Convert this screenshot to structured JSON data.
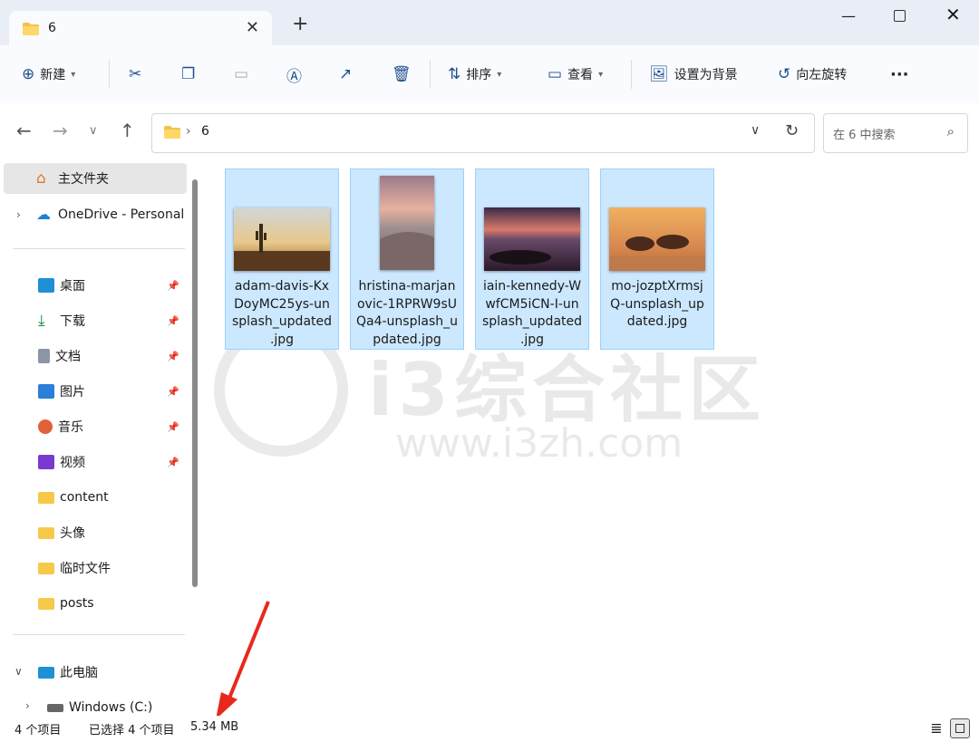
{
  "window": {
    "tab_title": "6",
    "new_tab_icon": "plus-icon"
  },
  "toolbar": {
    "new_label": "新建",
    "sort_label": "排序",
    "view_label": "查看",
    "set_bg_label": "设置为背景",
    "rotate_left_label": "向左旋转",
    "more_label": "···"
  },
  "address": {
    "path": "6",
    "search_placeholder": "在 6 中搜索"
  },
  "sidebar": {
    "home": "主文件夹",
    "onedrive": "OneDrive - Personal",
    "quick": [
      {
        "label": "桌面",
        "icon": "desktop-icon",
        "color": "#1e90d6"
      },
      {
        "label": "下载",
        "icon": "download-icon",
        "color": "#1a8a4a"
      },
      {
        "label": "文档",
        "icon": "document-icon",
        "color": "#6b7a8a"
      },
      {
        "label": "图片",
        "icon": "pictures-icon",
        "color": "#2a7fd8"
      },
      {
        "label": "音乐",
        "icon": "music-icon",
        "color": "#e0603a"
      },
      {
        "label": "视频",
        "icon": "video-icon",
        "color": "#7a3ad0"
      }
    ],
    "folders": [
      "content",
      "头像",
      "临时文件",
      "posts"
    ],
    "this_pc": "此电脑",
    "drive": "Windows (C:)"
  },
  "files": [
    {
      "name": "adam-davis-KxDoyMC25ys-unsplash_updated.jpg",
      "lines": [
        "adam-davis-Kx",
        "DoyMC25ys-un",
        "splash_updated",
        ".jpg"
      ]
    },
    {
      "name": "hristina-marjanovic-1RPRW9sUQa4-unsplash_updated.jpg",
      "lines": [
        "hristina-marjan",
        "ovic-1RPRW9sU",
        "Qa4-unsplash_u",
        "pdated.jpg"
      ]
    },
    {
      "name": "iain-kennedy-WwfCM5iCN-I-unsplash_updated.jpg",
      "lines": [
        "iain-kennedy-W",
        "wfCM5iCN-I-un",
        "splash_updated",
        ".jpg"
      ]
    },
    {
      "name": "mo-jozptXrmsjQ-unsplash_updated.jpg",
      "lines": [
        "mo-jozptXrmsj",
        "Q-unsplash_up",
        "dated.jpg"
      ]
    }
  ],
  "watermark": {
    "text": "i3综合社区",
    "url": "www.i3zh.com"
  },
  "status": {
    "count": "4 个项目",
    "selected": "已选择 4 个项目",
    "size": "5.34 MB"
  },
  "colors": {
    "accent": "#1f4f8f",
    "selection": "#cce8ff",
    "arrow": "#e8281e"
  }
}
